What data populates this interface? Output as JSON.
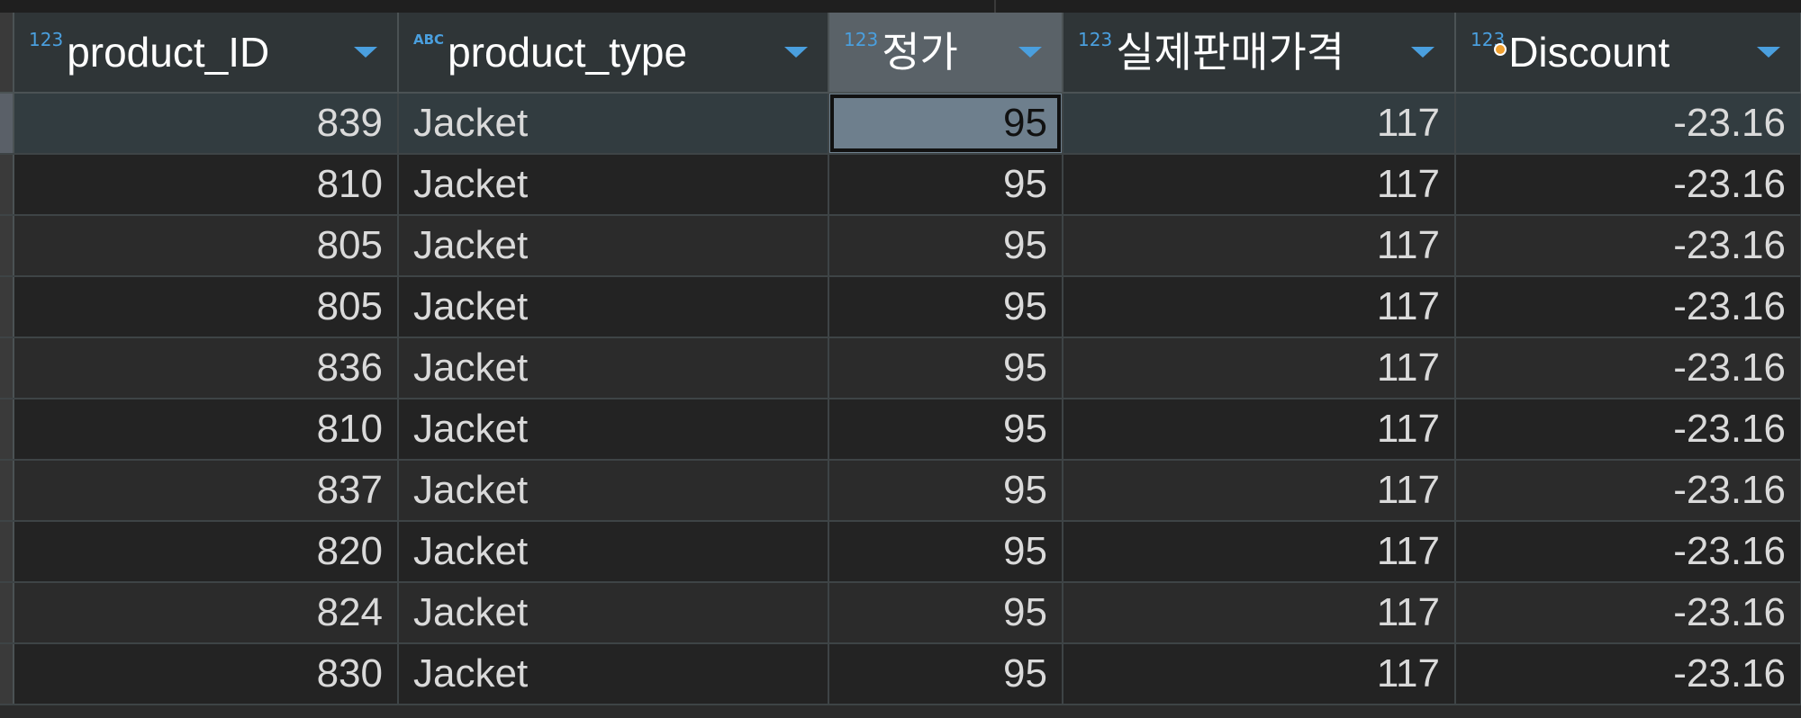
{
  "columns": [
    {
      "name": "product_ID",
      "type_badge": "123",
      "kind": "num",
      "has_dot": false
    },
    {
      "name": "product_type",
      "type_badge": "ABC",
      "kind": "txt",
      "has_dot": false
    },
    {
      "name": "정가",
      "type_badge": "123",
      "kind": "num",
      "has_dot": false
    },
    {
      "name": "실제판매가격",
      "type_badge": "123",
      "kind": "num",
      "has_dot": false
    },
    {
      "name": "Discount",
      "type_badge": "123",
      "kind": "num",
      "has_dot": true
    }
  ],
  "rows": [
    [
      "839",
      "Jacket",
      "95",
      "117",
      "-23.16"
    ],
    [
      "810",
      "Jacket",
      "95",
      "117",
      "-23.16"
    ],
    [
      "805",
      "Jacket",
      "95",
      "117",
      "-23.16"
    ],
    [
      "805",
      "Jacket",
      "95",
      "117",
      "-23.16"
    ],
    [
      "836",
      "Jacket",
      "95",
      "117",
      "-23.16"
    ],
    [
      "810",
      "Jacket",
      "95",
      "117",
      "-23.16"
    ],
    [
      "837",
      "Jacket",
      "95",
      "117",
      "-23.16"
    ],
    [
      "820",
      "Jacket",
      "95",
      "117",
      "-23.16"
    ],
    [
      "824",
      "Jacket",
      "95",
      "117",
      "-23.16"
    ],
    [
      "830",
      "Jacket",
      "95",
      "117",
      "-23.16"
    ]
  ],
  "selection": {
    "row": 0,
    "col": 2
  },
  "colors": {
    "accent": "#4a9fde",
    "dot": "#f0a030",
    "selected_cell": "#6e7f8d",
    "header_bg": "#2f3537",
    "active_header_bg": "#5a6268"
  },
  "icons": {
    "sort": "chevron-down-icon",
    "type_num": "numeric-type-icon",
    "type_text": "text-type-icon",
    "modified": "modified-dot-icon"
  }
}
